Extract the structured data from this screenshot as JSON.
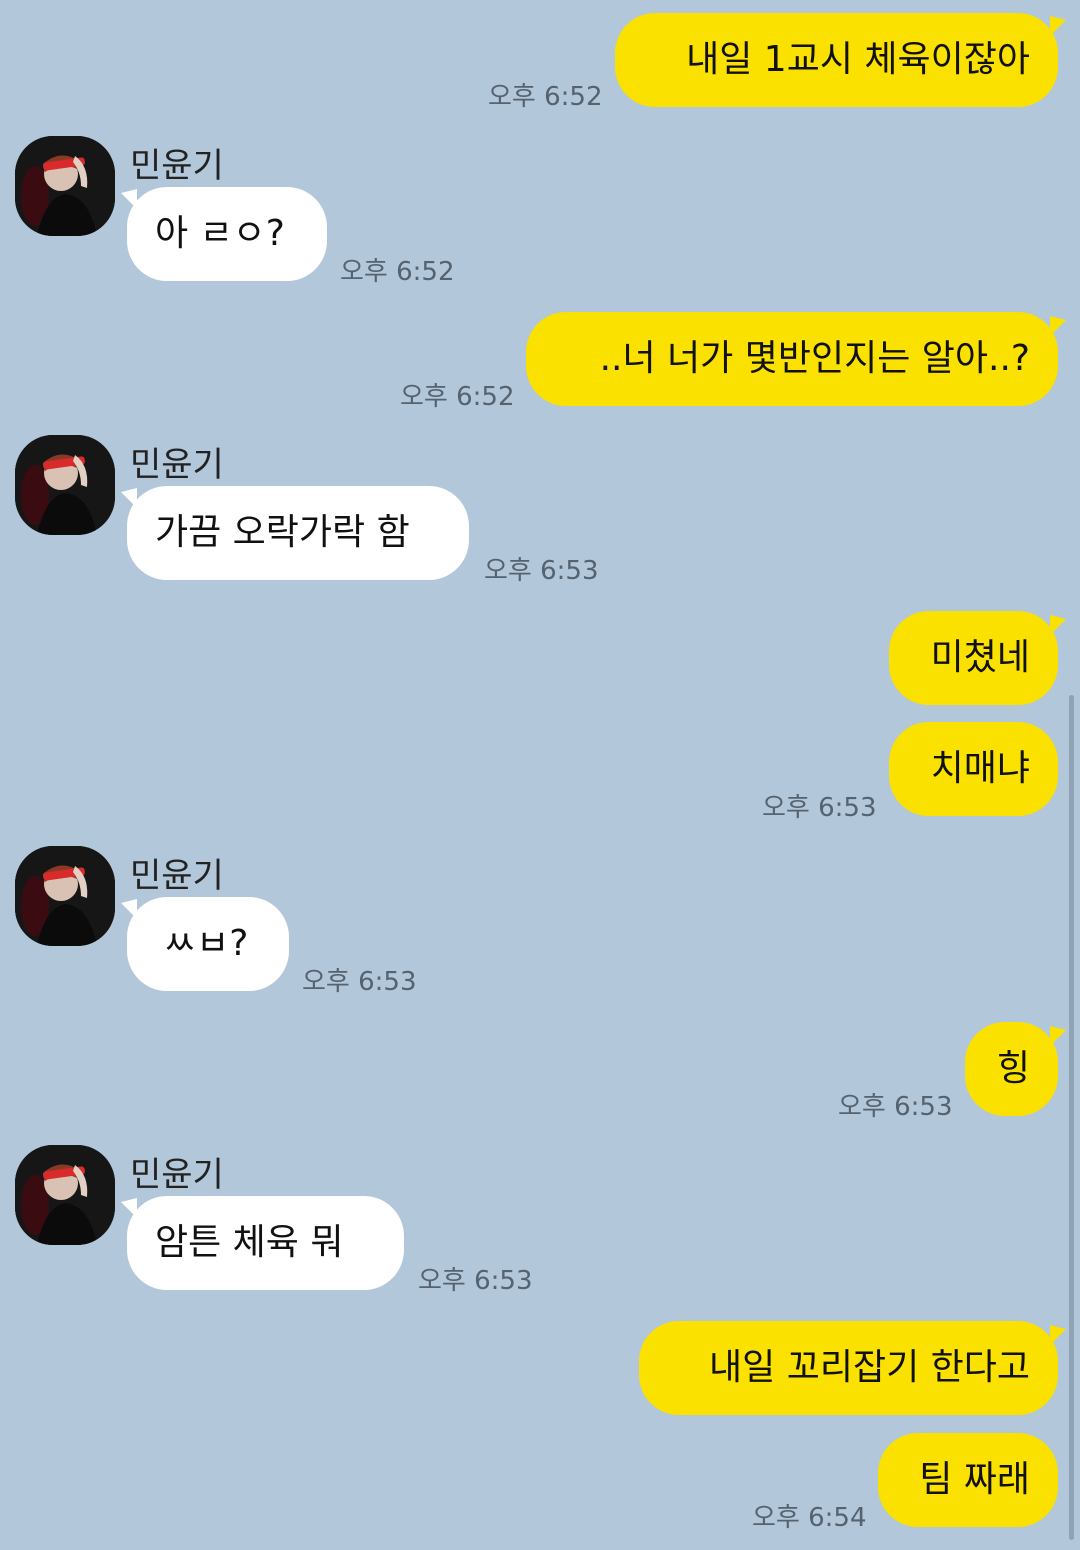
{
  "contact": {
    "name": "민윤기",
    "avatar_icon": "profile-photo-icon"
  },
  "colors": {
    "background": "#b2c7d9",
    "my_bubble": "#fae100",
    "their_bubble": "#ffffff"
  },
  "messages": [
    {
      "sender": "me",
      "text": "내일 1교시 체육이잖아",
      "time": "오후 6:52"
    },
    {
      "sender": "other",
      "text": "아 ㄹㅇ?",
      "time": "오후 6:52"
    },
    {
      "sender": "me",
      "text": "..너 너가 몇반인지는 알아..?",
      "time": "오후 6:52"
    },
    {
      "sender": "other",
      "text": "가끔 오락가락 함",
      "time": "오후 6:53"
    },
    {
      "sender": "me",
      "text": "미쳤네",
      "time": ""
    },
    {
      "sender": "me",
      "text": "치매냐",
      "time": "오후 6:53"
    },
    {
      "sender": "other",
      "text": "ㅆㅂ?",
      "time": "오후 6:53"
    },
    {
      "sender": "me",
      "text": "힝",
      "time": "오후 6:53"
    },
    {
      "sender": "other",
      "text": "암튼 체육 뭐",
      "time": "오후 6:53"
    },
    {
      "sender": "me",
      "text": "내일 꼬리잡기 한다고",
      "time": ""
    },
    {
      "sender": "me",
      "text": "팀 짜래",
      "time": "오후 6:54"
    }
  ]
}
